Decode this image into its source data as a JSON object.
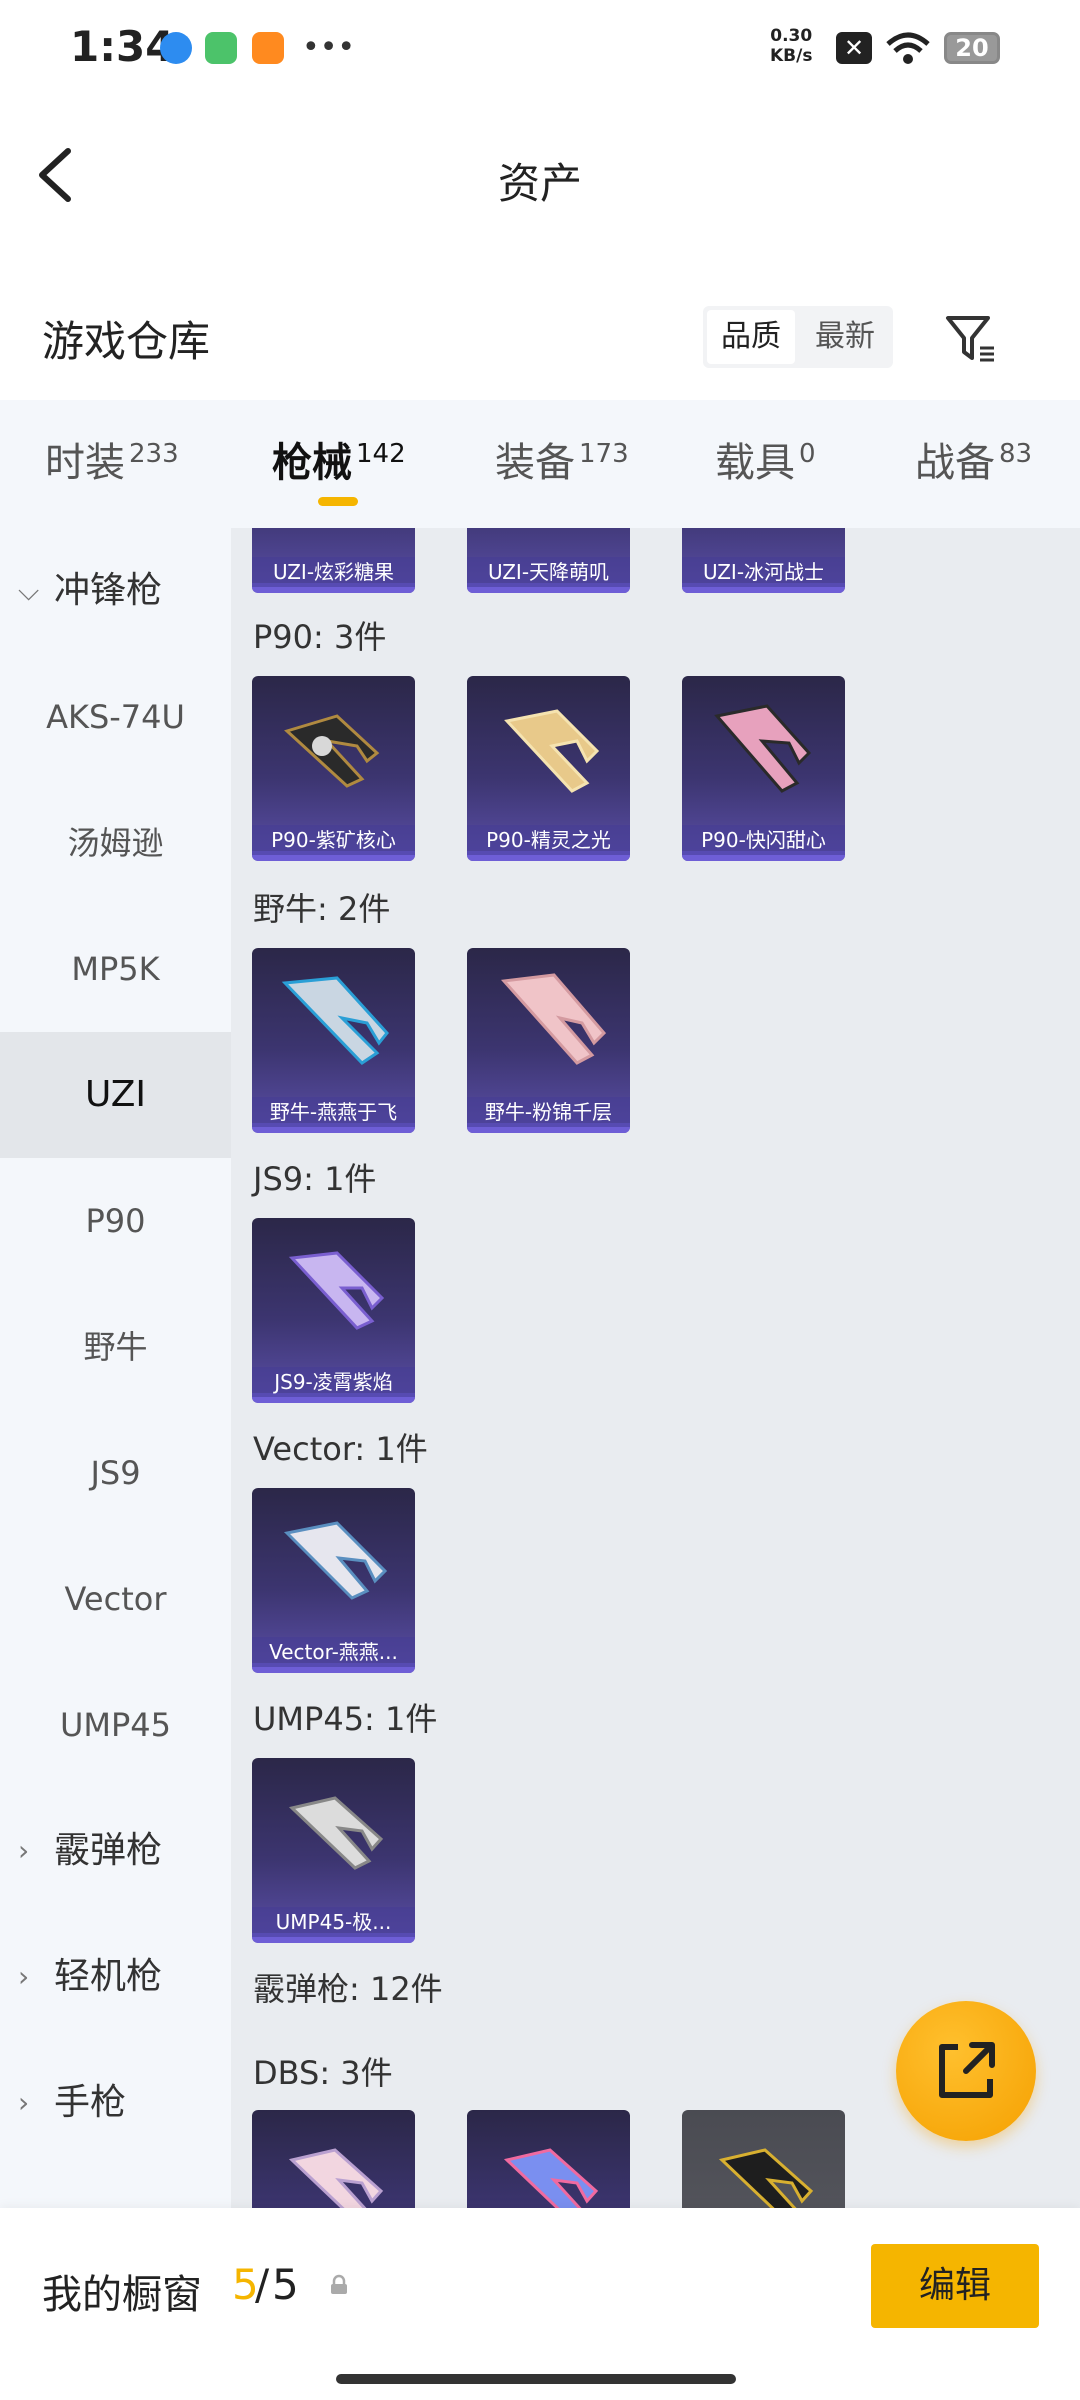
{
  "status": {
    "time": "1:34",
    "net_speed_value": "0.30",
    "net_speed_unit": "KB/s",
    "battery": "20"
  },
  "header": {
    "title": "资产"
  },
  "warehouse": {
    "title": "游戏仓库",
    "sort_quality": "品质",
    "sort_newest": "最新"
  },
  "tabs": [
    {
      "label": "时装",
      "count": "233"
    },
    {
      "label": "枪械",
      "count": "142"
    },
    {
      "label": "装备",
      "count": "173"
    },
    {
      "label": "载具",
      "count": "0"
    },
    {
      "label": "战备",
      "count": "83"
    }
  ],
  "sidebar": {
    "cat_smg": "冲锋枪",
    "items": [
      "AKS-74U",
      "汤姆逊",
      "MP5K",
      "UZI",
      "P90",
      "野牛",
      "JS9",
      "Vector",
      "UMP45"
    ],
    "cat_shotgun": "霰弹枪",
    "cat_lmg": "轻机枪",
    "cat_pistol": "手枪"
  },
  "content": {
    "uzi_cards": [
      "UZI-炫彩糖果",
      "UZI-天降萌叽",
      "UZI-冰河战士"
    ],
    "p90_label": "P90: 3件",
    "p90_cards": [
      "P90-紫矿核心",
      "P90-精灵之光",
      "P90-快闪甜心"
    ],
    "bison_label": "野牛: 2件",
    "bison_cards": [
      "野牛-燕燕于飞",
      "野牛-粉锦千层"
    ],
    "js9_label": "JS9: 1件",
    "js9_cards": [
      "JS9-凌霄紫焰"
    ],
    "vector_label": "Vector: 1件",
    "vector_cards": [
      "Vector-燕燕..."
    ],
    "ump_label": "UMP45: 1件",
    "ump_cards": [
      "UMP45-极..."
    ],
    "shotgun_label": "霰弹枪: 12件",
    "dbs_label": "DBS: 3件"
  },
  "bottom": {
    "showcase_label": "我的橱窗",
    "count_current": "5",
    "count_sep": "/",
    "count_total": "5",
    "edit_label": "编辑"
  },
  "colors": {
    "accent": "#f5b500",
    "sidebar_bg": "#f4f7fb",
    "content_bg": "#e9ecf0",
    "card_purple": "#3c3570"
  },
  "icons": [
    "back-arrow-icon",
    "filter-icon",
    "share-out-icon",
    "lock-icon",
    "chevron-down-icon",
    "chevron-right-icon",
    "wifi-icon",
    "battery-icon"
  ]
}
